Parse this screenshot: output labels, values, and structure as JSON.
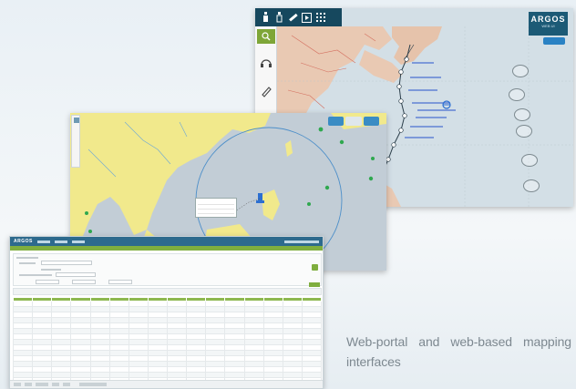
{
  "argos_window": {
    "logo_text": "ARGOS",
    "logo_subtext": "WEB UI",
    "toolbar_icons": [
      "beacon-icon",
      "beacon-alt-icon",
      "ruler-icon",
      "play-icon",
      "grid-icon"
    ],
    "side_icons": [
      "zoom-icon",
      "headset-icon",
      "pencil-icon"
    ],
    "accent_color": "#16485e",
    "map_land_color": "#e9c9b3",
    "map_sea_color": "#d3dfe6"
  },
  "asia_window": {
    "land_color": "#f1e98c",
    "sea_color": "#c2cdd6"
  },
  "table_window": {
    "logo_text": "ARGOS",
    "header_color": "#2d6a8d",
    "accent_color": "#8db84f",
    "column_count": 16,
    "row_count": 15
  },
  "caption": "Web-portal and web-based mapping interfaces"
}
